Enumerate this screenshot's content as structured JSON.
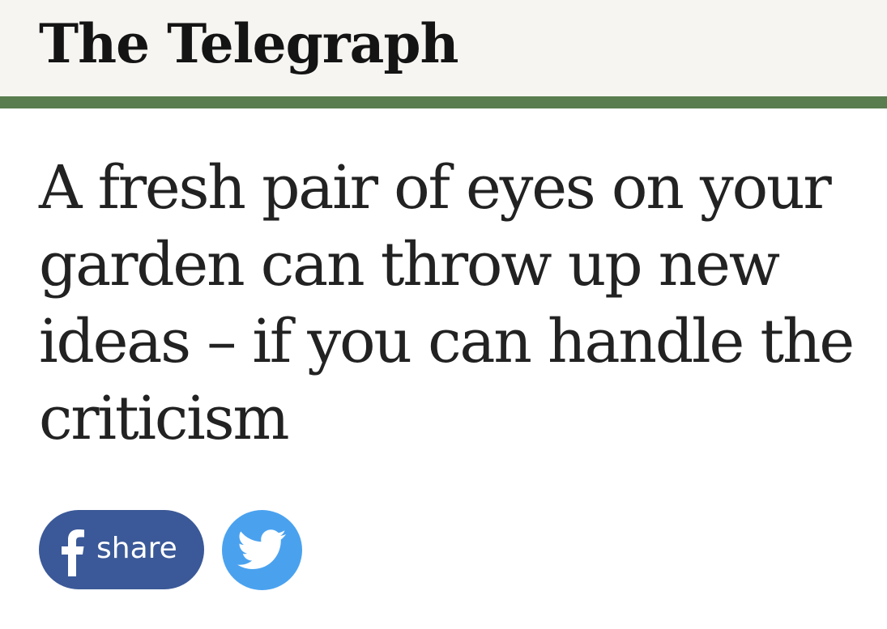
{
  "header": {
    "masthead": "The Telegraph",
    "rule_color": "#5a7d4f"
  },
  "article": {
    "headline": "A fresh pair of eyes on your garden can throw up new ideas – if you can handle the criticism"
  },
  "share": {
    "facebook_label": "share",
    "facebook_icon": "facebook-icon",
    "facebook_color": "#3b5998",
    "twitter_icon": "twitter-bird-icon",
    "twitter_color": "#4aa2ef"
  }
}
